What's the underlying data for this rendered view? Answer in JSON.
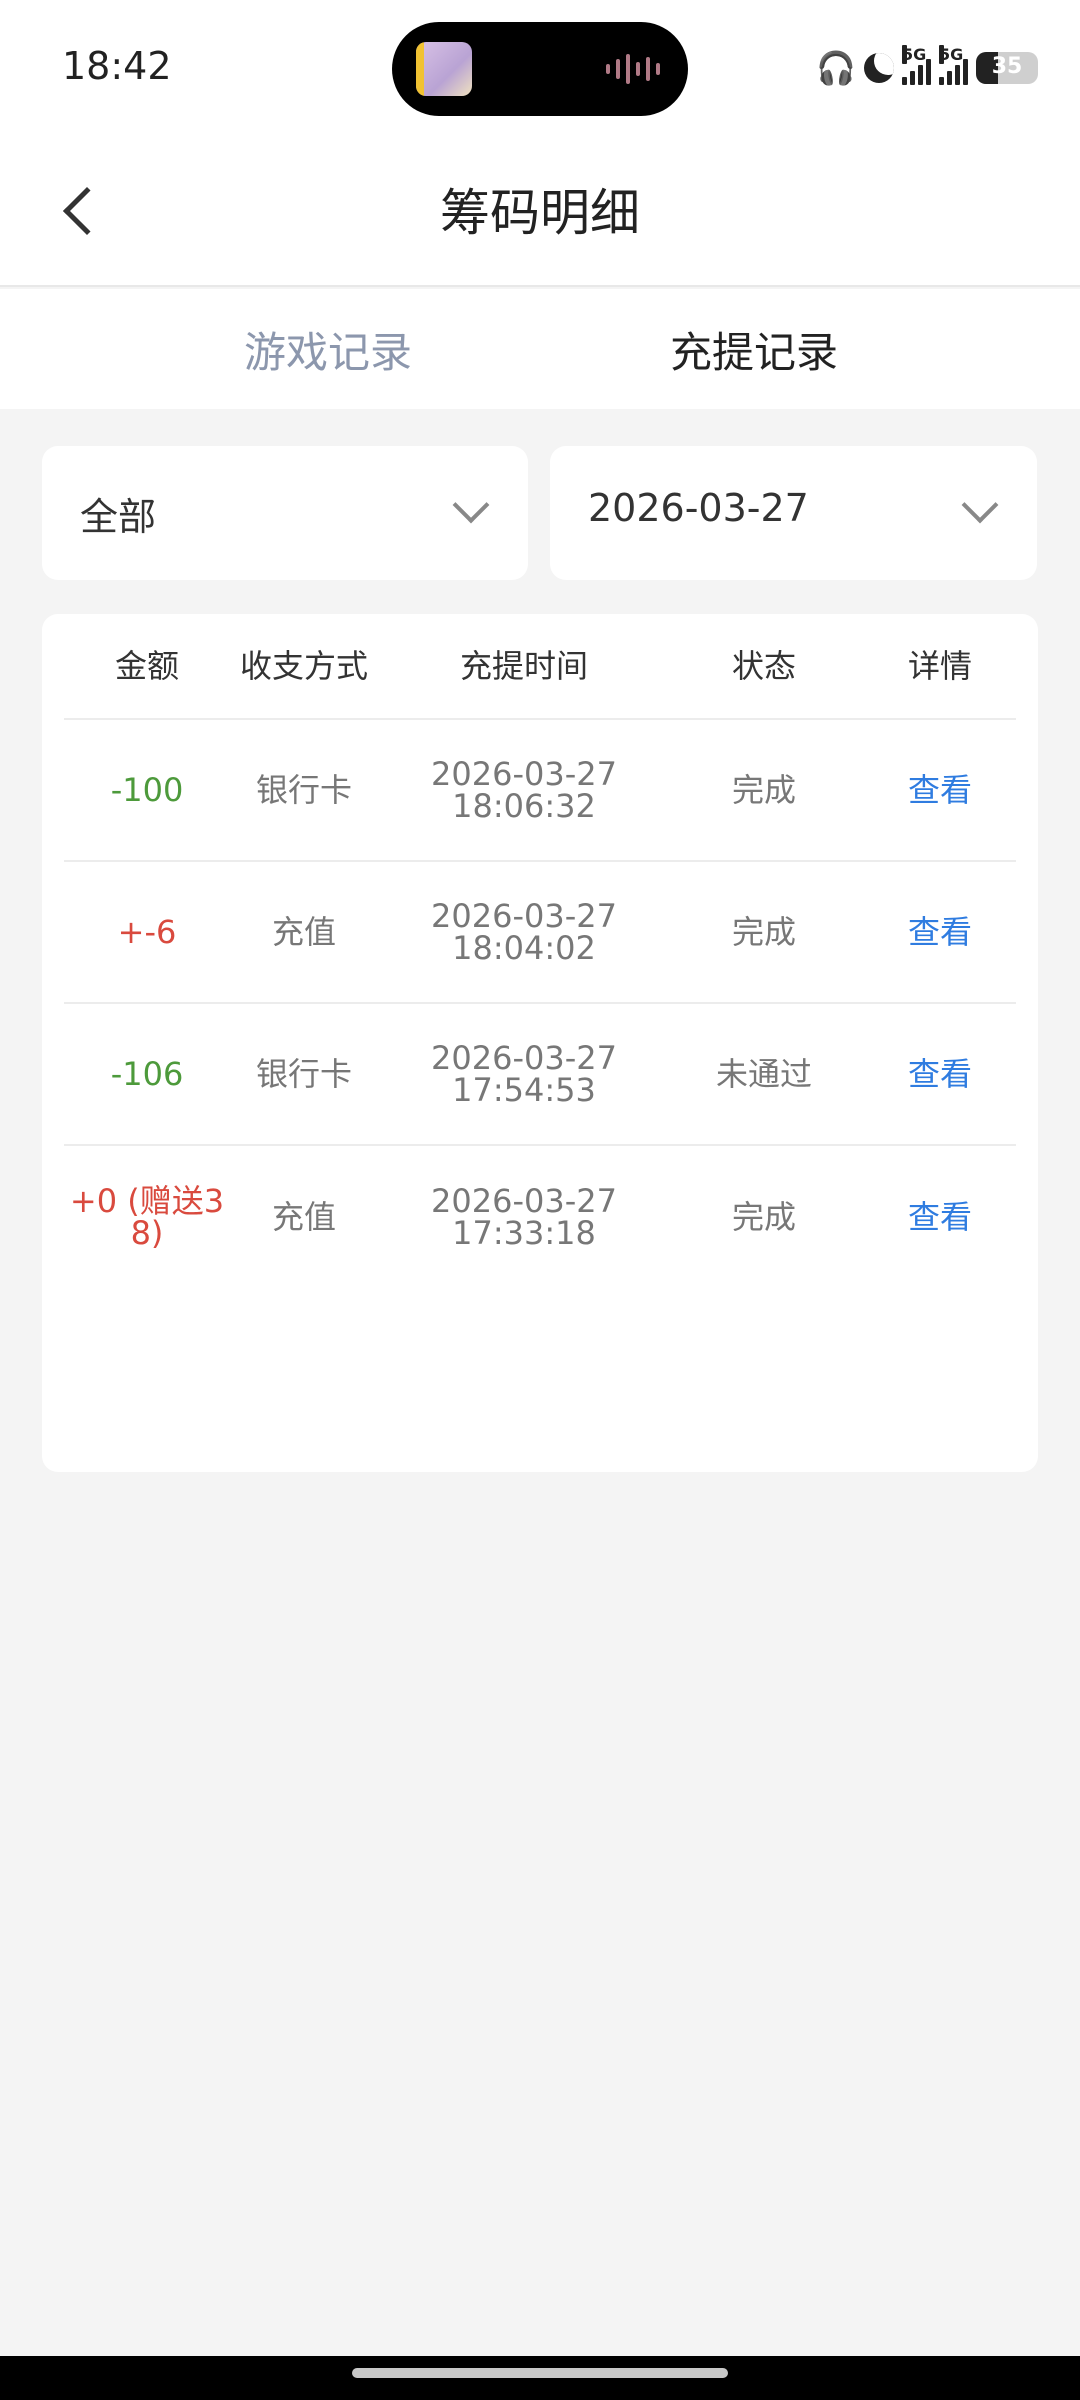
{
  "status_bar": {
    "time": "18:42",
    "network_1": "5G",
    "network_2": "5G",
    "battery": "35"
  },
  "header": {
    "title": "筹码明细"
  },
  "tabs": [
    {
      "label": "游戏记录",
      "active": false
    },
    {
      "label": "充提记录",
      "active": true
    }
  ],
  "filters": {
    "type_value": "全部",
    "date_value": "2026-03-27"
  },
  "table": {
    "columns": [
      "金额",
      "收支方式",
      "充提时间",
      "状态",
      "详情"
    ],
    "rows": [
      {
        "amount": "-100",
        "method": "银行卡",
        "date": "2026-03-27",
        "time": "18:06:32",
        "status": "完成",
        "detail": "查看"
      },
      {
        "amount": "+-6",
        "method": "充值",
        "date": "2026-03-27",
        "time": "18:04:02",
        "status": "完成",
        "detail": "查看"
      },
      {
        "amount": "-106",
        "method": "银行卡",
        "date": "2026-03-27",
        "time": "17:54:53",
        "status": "未通过",
        "detail": "查看"
      },
      {
        "amount_line1": "+0 (赠送3",
        "amount_line2": "8)",
        "method": "充值",
        "date": "2026-03-27",
        "time": "17:33:18",
        "status": "完成",
        "detail": "查看"
      }
    ]
  },
  "colors": {
    "negative": "#4d9a3b",
    "positive": "#d94a3e",
    "link": "#2f7ce0",
    "inactive_tab": "#8c97ad",
    "background": "#f4f4f4"
  },
  "icons": [
    "back-chevron-icon",
    "dropdown-chevron-icon",
    "signal-icon",
    "battery-icon",
    "moon-icon",
    "earbuds-icon"
  ]
}
